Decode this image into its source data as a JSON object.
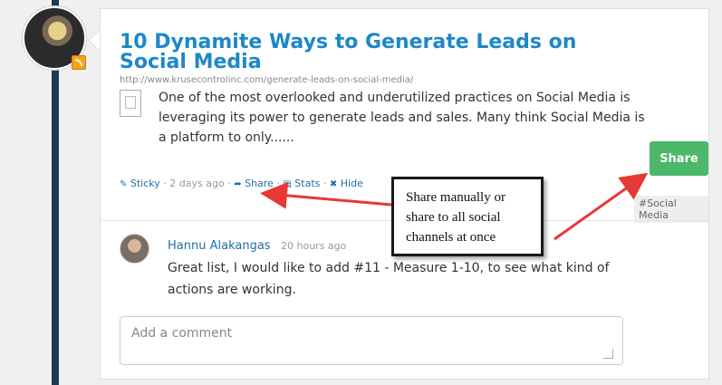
{
  "post": {
    "title": "10 Dynamite Ways to Generate Leads on Social Media",
    "url": "http://www.krusecontrolinc.com/generate-leads-on-social-media/",
    "excerpt": "One of the most overlooked and underutilized practices on Social Media is leveraging its power to generate leads and sales. Many think Social Media is a platform to only......"
  },
  "meta": {
    "sticky": "Sticky",
    "sep1": "·",
    "age": "2 days ago",
    "sep2": "·",
    "share": "Share",
    "sep3": "·",
    "stats": "Stats",
    "sep4": "·",
    "hide": "Hide"
  },
  "share_button": "Share",
  "tag": "#Social Media",
  "comment": {
    "author": "Hannu Alakangas",
    "time": "20 hours ago",
    "text": "Great list, I would like to add #11 - Measure 1-10, to see what kind of actions are working."
  },
  "comment_input": {
    "placeholder": "Add a comment"
  },
  "annotation": "Share manually or share to all social channels at once",
  "colors": {
    "accent": "#1e88c7",
    "share_green": "#4cb86a",
    "timeline": "#1d3a4f",
    "arrow": "#e53935"
  },
  "icons": [
    "rss-icon",
    "sticky-icon",
    "share-icon",
    "stats-icon",
    "hide-icon",
    "resize-grip-icon"
  ]
}
